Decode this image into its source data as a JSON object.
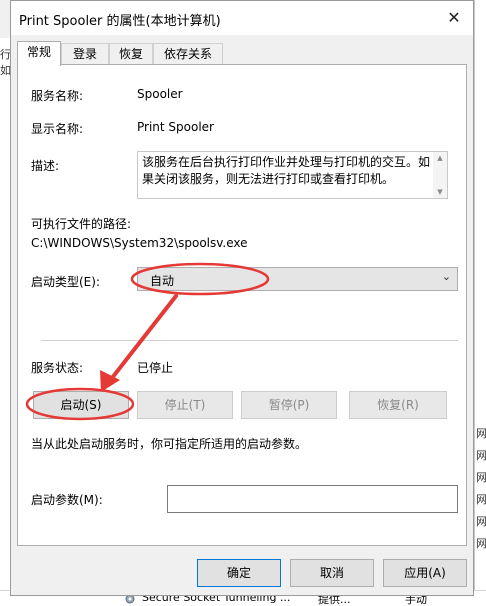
{
  "background": {
    "left_edge_chars": [
      "行",
      "如"
    ],
    "right_edge_chars": [
      "网",
      "网",
      "网",
      "网",
      "网",
      "网"
    ],
    "bottom_row": {
      "service_name": "Secure Socket Tunneling ...",
      "description": "提供...",
      "startup": "手动"
    }
  },
  "dialog": {
    "title": "Print Spooler 的属性(本地计算机)",
    "close_label": "✕",
    "tabs": [
      {
        "label": "常规",
        "active": true
      },
      {
        "label": "登录",
        "active": false
      },
      {
        "label": "恢复",
        "active": false
      },
      {
        "label": "依存关系",
        "active": false
      }
    ],
    "general": {
      "service_name_label": "服务名称:",
      "service_name_value": "Spooler",
      "display_name_label": "显示名称:",
      "display_name_value": "Print Spooler",
      "description_label": "描述:",
      "description_value": "该服务在后台执行打印作业并处理与打印机的交互。如果关闭该服务，则无法进行打印或查看打印机。",
      "exe_path_label": "可执行文件的路径:",
      "exe_path_value": "C:\\WINDOWS\\System32\\spoolsv.exe",
      "startup_type_label": "启动类型(E):",
      "startup_type_value": "自动",
      "service_status_label": "服务状态:",
      "service_status_value": "已停止",
      "buttons": {
        "start": "启动(S)",
        "stop": "停止(T)",
        "pause": "暂停(P)",
        "resume": "恢复(R)"
      },
      "hint_text": "当从此处启动服务时，你可指定所适用的启动参数。",
      "start_params_label": "启动参数(M):",
      "start_params_value": ""
    },
    "footer": {
      "ok": "确定",
      "cancel": "取消",
      "apply": "应用(A)"
    }
  },
  "colors": {
    "annotation_red": "#e53935",
    "dialog_bg": "#f0f0f0",
    "panel_bg": "#ffffff",
    "primary_border": "#0078d7"
  },
  "icons": {
    "close": "close-icon",
    "dropdown": "chevron-down-icon",
    "service": "gear-icon"
  }
}
